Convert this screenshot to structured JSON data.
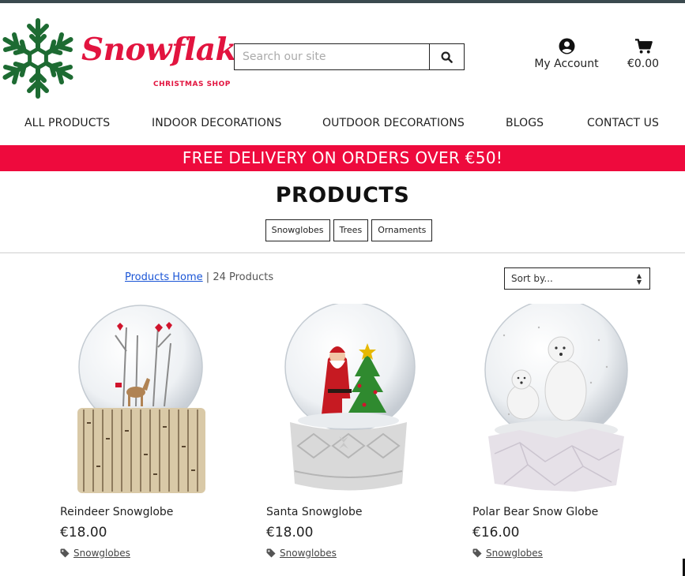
{
  "brand": {
    "name": "Snowflakes",
    "tagline": "CHRISTMAS SHOP",
    "primary_color": "#e2143f",
    "logo_icon": "snowflake-icon"
  },
  "search": {
    "placeholder": "Search our site",
    "value": "",
    "icon": "search-icon"
  },
  "account": {
    "label": "My Account",
    "icon": "user-circle-icon"
  },
  "cart": {
    "total": "€0.00",
    "icon": "shopping-cart-icon"
  },
  "nav": {
    "items": [
      {
        "label": "ALL PRODUCTS"
      },
      {
        "label": "INDOOR DECORATIONS"
      },
      {
        "label": "OUTDOOR DECORATIONS"
      },
      {
        "label": "BLOGS"
      },
      {
        "label": "CONTACT US"
      }
    ]
  },
  "banner": {
    "text": "FREE DELIVERY ON ORDERS OVER €50!",
    "color": "#ee0a3d"
  },
  "page": {
    "title": "PRODUCTS"
  },
  "filters": [
    {
      "label": "Snowglobes"
    },
    {
      "label": "Trees"
    },
    {
      "label": "Ornaments"
    }
  ],
  "breadcrumb": {
    "link": "Products Home",
    "separator": " | ",
    "count": "24 Products"
  },
  "sort": {
    "selected": "Sort by..."
  },
  "products": [
    {
      "name": "Reindeer Snowglobe",
      "price": "€18.00",
      "category": "Snowglobes",
      "tag_icon": "tag-icon"
    },
    {
      "name": "Santa Snowglobe",
      "price": "€18.00",
      "category": "Snowglobes",
      "tag_icon": "tag-icon"
    },
    {
      "name": "Polar Bear Snow Globe",
      "price": "€16.00",
      "category": "Snowglobes",
      "tag_icon": "tag-icon"
    }
  ]
}
